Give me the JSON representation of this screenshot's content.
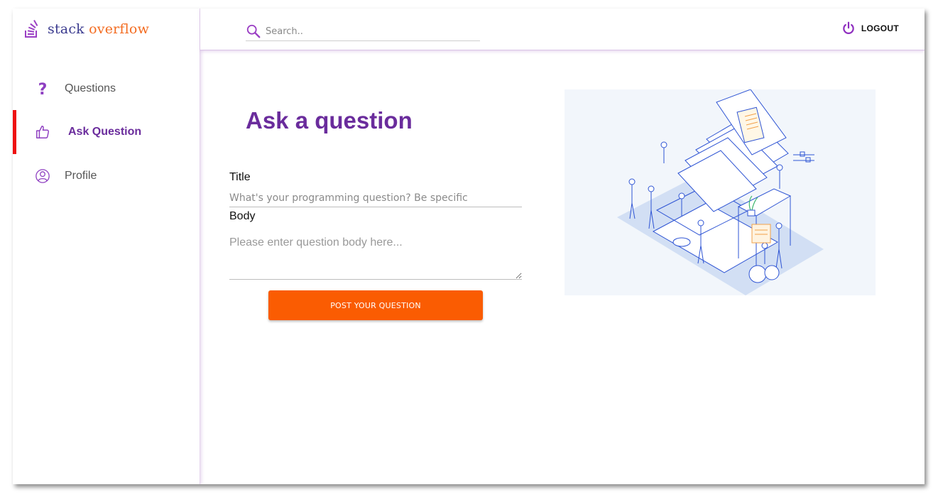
{
  "brand": {
    "name_part1": "stack",
    "name_part2": "overflow"
  },
  "sidebar": {
    "items": [
      {
        "label": "Questions",
        "icon": "question-mark-icon"
      },
      {
        "label": "Ask Question",
        "icon": "thumbs-up-icon",
        "active": true
      },
      {
        "label": "Profile",
        "icon": "user-circle-icon"
      }
    ]
  },
  "search": {
    "placeholder": "Search.."
  },
  "header": {
    "logout_label": "LOGOUT"
  },
  "main": {
    "title": "Ask a question",
    "title_field_label": "Title",
    "title_placeholder": "What's your programming question? Be specific",
    "body_field_label": "Body",
    "body_placeholder": "Please enter question body here...",
    "submit_label": "POST YOUR QUESTION"
  },
  "colors": {
    "brand_purple": "#6a2c9c",
    "accent_orange": "#fa5c02",
    "active_indicator": "#ee1111",
    "logo_orange": "#f36c21"
  }
}
